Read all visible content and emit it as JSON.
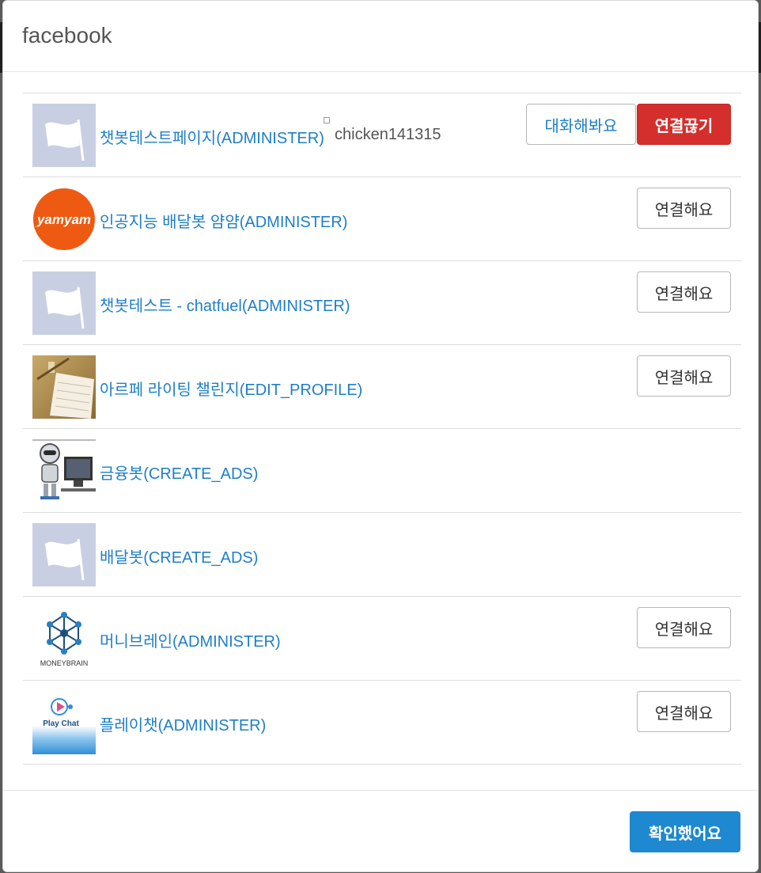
{
  "modal": {
    "title": "facebook",
    "confirm_label": "확인했어요"
  },
  "pages": [
    {
      "name": "챗봇테스트페이지(ADMINISTER)",
      "thumbnail": "default-flag",
      "owner": "chicken141315",
      "chat_label": "대화해봐요",
      "disconnect_label": "연결끊기",
      "connected": true
    },
    {
      "name": "인공지능 배달봇 얌얌(ADMINISTER)",
      "thumbnail": "yamyam-logo",
      "thumbnail_text": "yamyam",
      "connect_label": "연결해요"
    },
    {
      "name": "챗봇테스트 - chatfuel(ADMINISTER)",
      "thumbnail": "default-flag",
      "connect_label": "연결해요"
    },
    {
      "name": "아르페 라이팅 챌린지(EDIT_PROFILE)",
      "thumbnail": "notebook-photo",
      "connect_label": "연결해요"
    },
    {
      "name": "금융봇(CREATE_ADS)",
      "thumbnail": "robot-computer-photo"
    },
    {
      "name": "배달봇(CREATE_ADS)",
      "thumbnail": "default-flag"
    },
    {
      "name": "머니브레인(ADMINISTER)",
      "thumbnail": "moneybrain-logo",
      "thumbnail_text": "MONEYBRAIN",
      "connect_label": "연결해요"
    },
    {
      "name": "플레이챗(ADMINISTER)",
      "thumbnail": "playchat-logo",
      "thumbnail_text": "Play Chat",
      "connect_label": "연결해요"
    }
  ],
  "colors": {
    "link": "#1e7fc7",
    "danger": "#d42f2c",
    "primary": "#1e88d0",
    "flag_bg": "#c9cfe3",
    "yamyam_orange": "#ee5a12"
  }
}
